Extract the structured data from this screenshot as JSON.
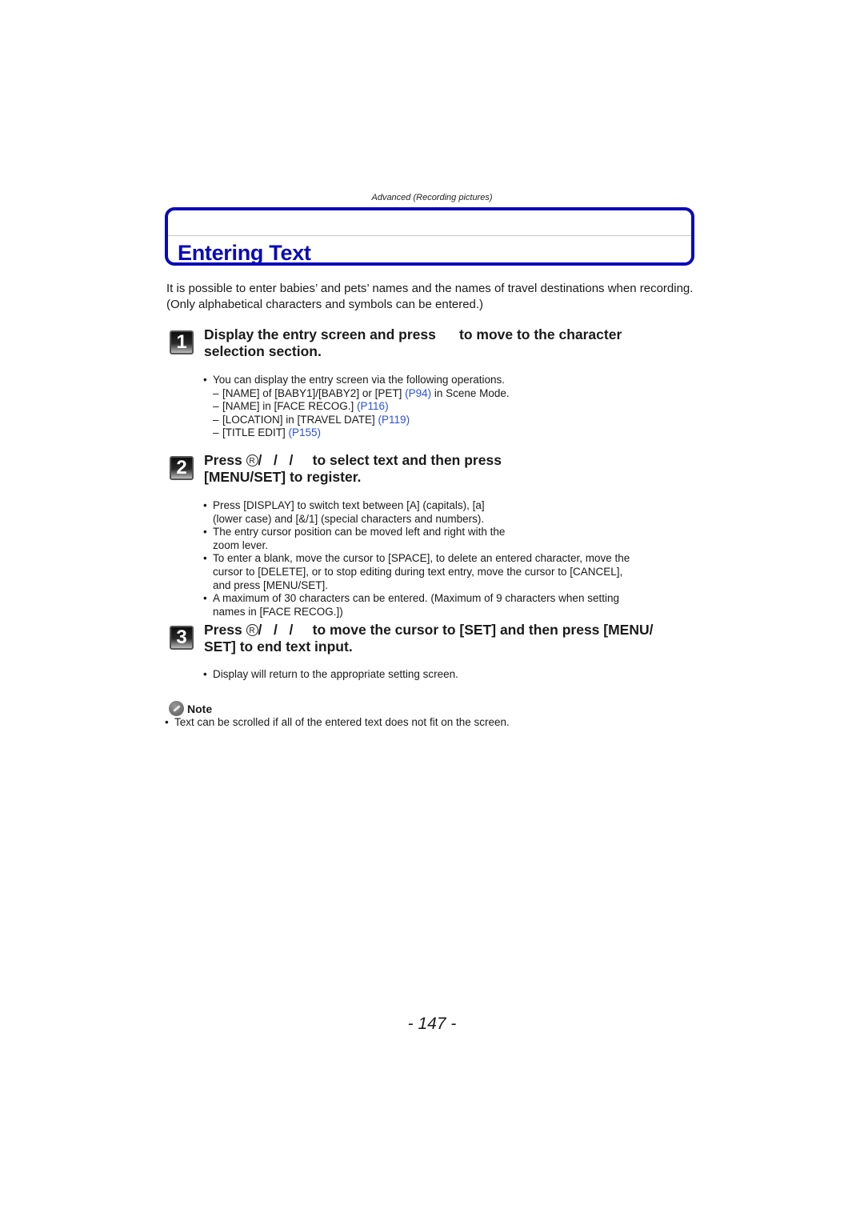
{
  "header": {
    "section_label": "Advanced (Recording pictures)"
  },
  "title": "Entering Text",
  "intro": "It is possible to enter babies’ and pets’ names and the names of travel destinations when recording. (Only alphabetical characters and symbols can be entered.)",
  "steps": [
    {
      "number": "1",
      "title_line1": "Display the entry screen and press      to move to the character",
      "title_line2": "selection section.",
      "bullets": [
        {
          "text": "You can display the entry screen via the following operations.",
          "subitems": [
            {
              "text": "[NAME] of [BABY1]/[BABY2] or [PET] ",
              "link": "(P94)",
              "after": " in Scene Mode."
            },
            {
              "text": "[NAME] in [FACE RECOG.] ",
              "link": "(P116)",
              "after": ""
            },
            {
              "text": "[LOCATION] in [TRAVEL DATE] ",
              "link": "(P119)",
              "after": ""
            },
            {
              "text": "[TITLE EDIT] ",
              "link": "(P155)",
              "after": ""
            }
          ]
        }
      ]
    },
    {
      "number": "2",
      "title_press": "Press ",
      "button_glyph": "R",
      "title_line1_rest": "/   /   /     to select text and then press",
      "title_line2": "[MENU/SET] to register.",
      "bullets": [
        {
          "line1": "Press [DISPLAY] to switch text between [A] (capitals), [a]",
          "line2": "(lower case) and [&/1] (special characters and numbers)."
        },
        {
          "line1": "The entry cursor position can be moved left and right with the",
          "line2": "zoom lever."
        },
        {
          "line1": "To enter a blank, move the cursor to [SPACE], to delete an entered character, move the",
          "line2": "cursor to [DELETE], or to stop editing during text entry, move the cursor to [CANCEL],",
          "line3": "and press [MENU/SET]."
        },
        {
          "line1": "A maximum of 30 characters can be entered. (Maximum of 9 characters when setting",
          "line2": "names in [FACE RECOG.])"
        }
      ]
    },
    {
      "number": "3",
      "title_press": "Press ",
      "button_glyph": "R",
      "title_line1_rest": "/   /   /     to move the cursor to [SET] and then press [MENU/",
      "title_line2": "SET] to end text input.",
      "bullets": [
        {
          "line1": "Display will return to the appropriate setting screen."
        }
      ]
    }
  ],
  "note": {
    "heading": "Note",
    "icon": "pencil-note-icon",
    "items": [
      "Text can be scrolled if all of the entered text does not fit on the screen."
    ]
  },
  "page_number": "- 147 -",
  "colors": {
    "title_blue": "#0a0ab8",
    "link_blue": "#2b50e0"
  }
}
